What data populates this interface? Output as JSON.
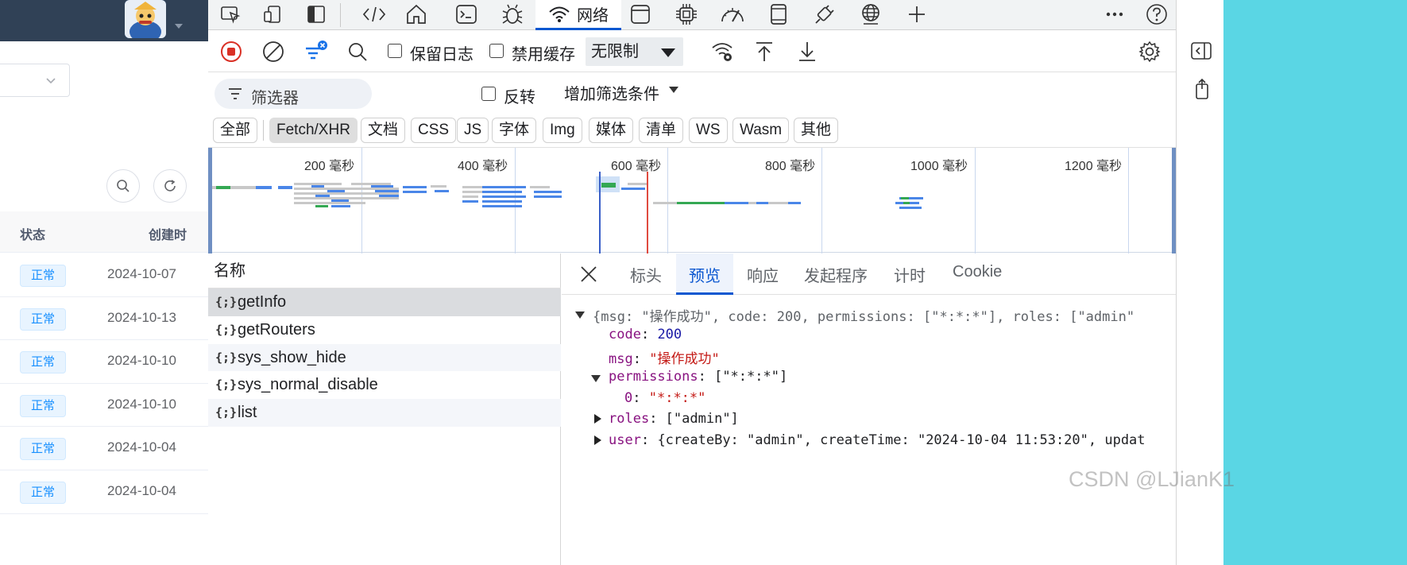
{
  "left_page": {
    "status_header": "状态",
    "created_header": "创建时",
    "rows": [
      {
        "status": "正常",
        "date": "2024-10-07"
      },
      {
        "status": "正常",
        "date": "2024-10-13"
      },
      {
        "status": "正常",
        "date": "2024-10-10"
      },
      {
        "status": "正常",
        "date": "2024-10-10"
      },
      {
        "status": "正常",
        "date": "2024-10-04"
      },
      {
        "status": "正常",
        "date": "2024-10-04"
      }
    ]
  },
  "devtools": {
    "tabs": {
      "network_label": "网络",
      "icons": [
        "inspect-icon",
        "device-icon",
        "sidebar-icon",
        "elements-icon",
        "welcome-icon",
        "console-icon",
        "sources-icon",
        "network-icon",
        "application-icon",
        "performance-icon",
        "memory-icon",
        "lighthouse-icon",
        "security-icon",
        "add-icon",
        "more-icon",
        "help-icon",
        "close-icon"
      ]
    },
    "toolbar": {
      "preserve_log": "保留日志",
      "disable_cache": "禁用缓存",
      "throttle": "无限制"
    },
    "filter": {
      "placeholder": "筛选器",
      "invert": "反转",
      "more_filters": "增加筛选条件"
    },
    "types": [
      "全部",
      "Fetch/XHR",
      "文档",
      "CSS",
      "JS",
      "字体",
      "Img",
      "媒体",
      "清单",
      "WS",
      "Wasm",
      "其他"
    ],
    "active_type": "Fetch/XHR",
    "overview": {
      "ticks": [
        "200 毫秒",
        "400 毫秒",
        "600 毫秒",
        "800 毫秒",
        "1000 毫秒",
        "1200 毫秒"
      ]
    },
    "requests": {
      "header": "名称",
      "items": [
        "getInfo",
        "getRouters",
        "sys_show_hide",
        "sys_normal_disable",
        "list"
      ],
      "icon_glyph": "{;}"
    },
    "detail": {
      "tabs": [
        "标头",
        "预览",
        "响应",
        "发起程序",
        "计时",
        "Cookie"
      ],
      "active_tab": "预览",
      "summary": "{msg: \"操作成功\", code: 200, permissions: [\"*:*:*\"], roles: [\"admin\"",
      "code_key": "code",
      "code_value": "200",
      "msg_key": "msg",
      "msg_value": "\"操作成功\"",
      "permissions_key": "permissions",
      "permissions_value": "[\"*:*:*\"]",
      "perm0_key": "0",
      "perm0_value": "\"*:*:*\"",
      "roles_key": "roles",
      "roles_value": "[\"admin\"]",
      "user_key": "user",
      "user_value": "{createBy: \"admin\", createTime: \"2024-10-04 11:53:20\", updat"
    }
  },
  "watermark": "CSDN @LJianK1"
}
